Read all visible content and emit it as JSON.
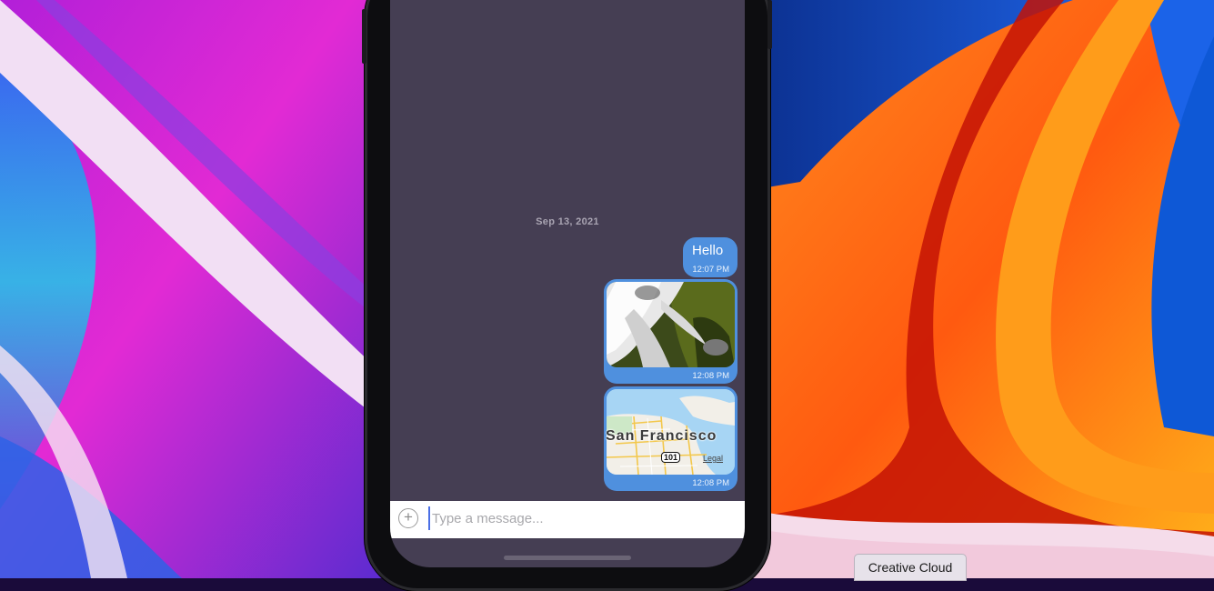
{
  "wallpaper": {
    "name": "macos-big-sur-wallpaper"
  },
  "chat": {
    "date_separator": "Sep 13, 2021",
    "messages": [
      {
        "type": "text",
        "text": "Hello",
        "time": "12:07 PM"
      },
      {
        "type": "image",
        "time": "12:08 PM"
      },
      {
        "type": "location",
        "map_label": "San Francisco",
        "highway": "101",
        "legal": "Legal",
        "time": "12:08 PM"
      }
    ]
  },
  "composer": {
    "add_icon": "plus-circle-icon",
    "placeholder": "Type a message...",
    "value": ""
  },
  "dock": {
    "tooltip": "Creative Cloud"
  },
  "colors": {
    "chat_background": "#453e53",
    "bubble": "#4f90de",
    "composer_background": "#ffffff"
  }
}
